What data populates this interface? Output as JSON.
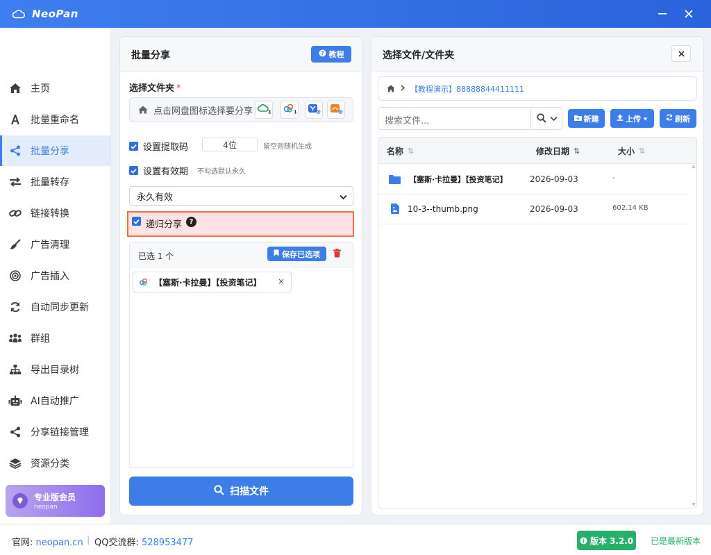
{
  "app": {
    "title": "NeoPan"
  },
  "sidebar": {
    "items": [
      {
        "label": "主页",
        "icon": "home-icon"
      },
      {
        "label": "批量重命名",
        "icon": "font-icon"
      },
      {
        "label": "批量分享",
        "icon": "share-icon",
        "active": true
      },
      {
        "label": "批量转存",
        "icon": "transfer-icon"
      },
      {
        "label": "链接转换",
        "icon": "link-icon"
      },
      {
        "label": "广告清理",
        "icon": "broom-icon"
      },
      {
        "label": "广告插入",
        "icon": "target-icon"
      },
      {
        "label": "自动同步更新",
        "icon": "sync-icon"
      },
      {
        "label": "群组",
        "icon": "group-icon"
      },
      {
        "label": "导出目录树",
        "icon": "sitemap-icon"
      },
      {
        "label": "AI自动推广",
        "icon": "robot-icon"
      },
      {
        "label": "分享链接管理",
        "icon": "share-alt-icon"
      },
      {
        "label": "资源分类",
        "icon": "layers-icon"
      }
    ],
    "vip": {
      "title": "专业版会员",
      "user": "neopan"
    }
  },
  "batch_share": {
    "title": "批量分享",
    "tutorial_label": "教程",
    "folder_label": "选择文件夹",
    "required_mark": "*",
    "folder_placeholder": "点击网盘图标选择要分享",
    "disk_badge": "1",
    "extract_code": {
      "label": "设置提取码",
      "value": "4位",
      "hint": "留空则随机生成",
      "checked": true
    },
    "validity": {
      "label": "设置有效期",
      "hint": "不勾选默认永久",
      "checked": true,
      "selected": "永久有效"
    },
    "recursive": {
      "label": "递归分享",
      "checked": true,
      "help": "?"
    },
    "selected": {
      "count_text": "已选 1 个",
      "save_label": "保存已选项",
      "items": [
        {
          "name": "【塞斯·卡拉曼】【投资笔记】"
        }
      ]
    },
    "scan_label": "扫描文件"
  },
  "file_picker": {
    "title": "选择文件/文件夹",
    "breadcrumb": "【教程演示】88888844411111",
    "search_placeholder": "搜索文件...",
    "buttons": {
      "new": "新建",
      "upload": "上传",
      "refresh": "刷新"
    },
    "columns": {
      "name": "名称",
      "date": "修改日期",
      "size": "大小"
    },
    "rows": [
      {
        "type": "folder",
        "name": "【塞斯·卡拉曼】【投资笔记】",
        "date": "2026-09-03",
        "size": "-"
      },
      {
        "type": "file",
        "name": "10-3--thumb.png",
        "date": "2026-09-03",
        "size": "602.14 KB"
      }
    ]
  },
  "footer": {
    "site_label": "官网:",
    "site": "neopan.cn",
    "separator": "|",
    "qq_label": "QQ交流群:",
    "qq": "528953477",
    "version": "版本 3.2.0",
    "status": "已是最新版本"
  },
  "colors": {
    "accent": "#3c7de8",
    "success": "#26b06a",
    "highlight_border": "#f0713e",
    "highlight_bg": "#fde3e3"
  }
}
